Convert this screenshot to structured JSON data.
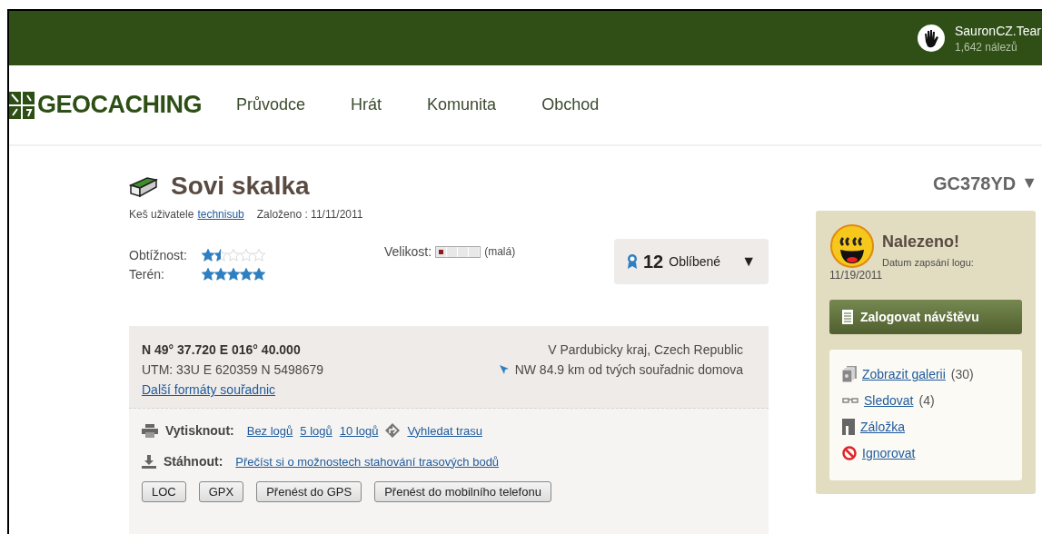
{
  "topbar": {
    "username": "SauronCZ.Tear",
    "finds": "1,642 nálezů"
  },
  "logo": {
    "text": "GEOCACHING"
  },
  "nav": [
    {
      "label": "Průvodce"
    },
    {
      "label": "Hrát"
    },
    {
      "label": "Komunita"
    },
    {
      "label": "Obchod"
    }
  ],
  "cache": {
    "title": "Sovi skalka",
    "code": "GC378YD",
    "code_toggle": "▼",
    "owner_prefix": "Keš uživatele",
    "owner": "technisub",
    "placed": "Založeno : 11/11/2011"
  },
  "ratings": [
    {
      "label": "Obtížnost:",
      "stars": 1.5
    },
    {
      "label": "Terén:",
      "stars": 5
    }
  ],
  "size": {
    "label": "Velikost:",
    "level": 0.25,
    "text": "(malá)"
  },
  "favorites": {
    "count": "12",
    "label": "Oblíbené",
    "toggle": "▼"
  },
  "coords": {
    "main": "N 49° 37.720 E 016° 40.000",
    "utm": "UTM: 33U E 620359 N 5498679",
    "more_link": "Další formáty souřadnic",
    "region": "V Pardubicky kraj, Czech Republic",
    "distance": "NW 84.9 km od tvých souřadnic domova"
  },
  "print": {
    "label": "Vytisknout:",
    "links": [
      "Bez logů",
      "5 logů",
      "10 logů"
    ],
    "route_link": "Vyhledat trasu"
  },
  "download": {
    "label": "Stáhnout:",
    "link": "Přečíst si o možnostech stahování trasových bodů"
  },
  "buttons": [
    "LOC",
    "GPX",
    "Přenést do GPS",
    "Přenést do mobilního telefonu"
  ],
  "log_status": {
    "title": "Nalezeno!",
    "date_label": "Datum zapsání logu:",
    "date": "11/19/2011"
  },
  "log_button": "Zalogovat návštěvu",
  "actions": [
    {
      "kind": "gallery",
      "label": "Zobrazit galerii",
      "count": "(30)"
    },
    {
      "kind": "watch",
      "label": "Sledovat",
      "count": "(4)"
    },
    {
      "kind": "bookmark",
      "label": "Záložka"
    },
    {
      "kind": "ignore",
      "label": "Ignorovat"
    }
  ]
}
